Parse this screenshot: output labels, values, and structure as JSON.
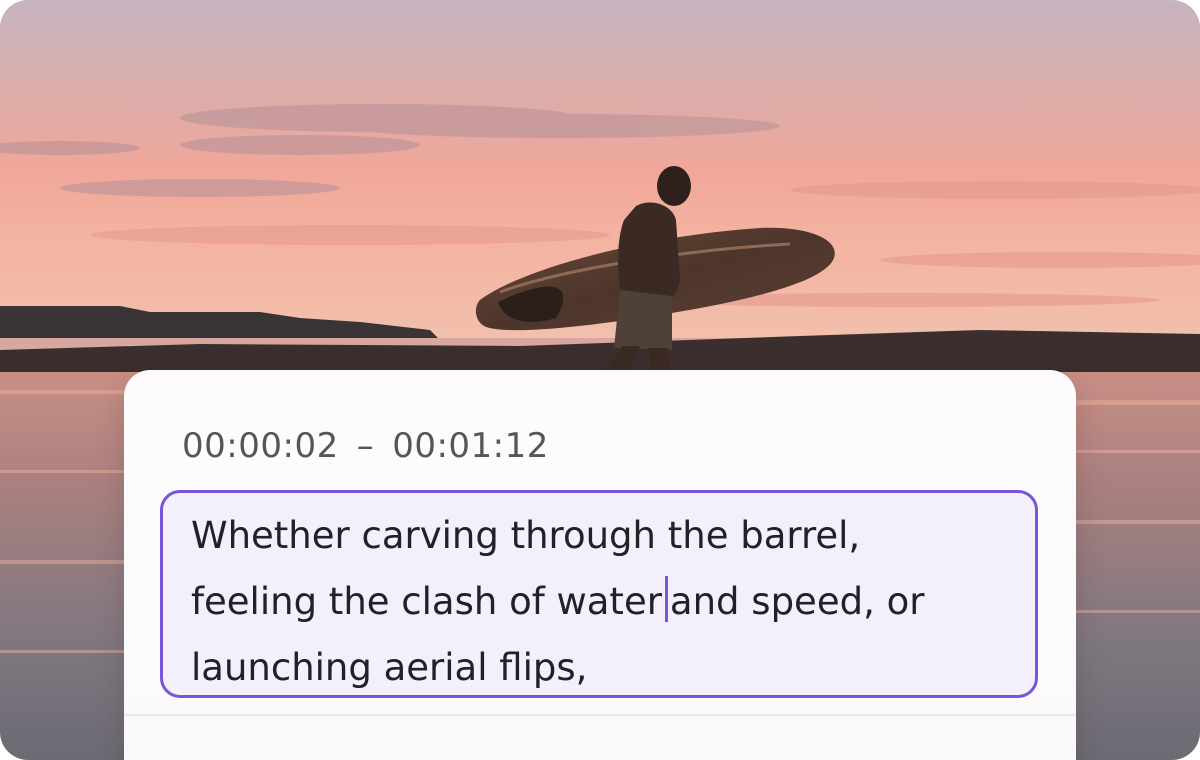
{
  "caption": {
    "start_time": "00:00:02",
    "separator": "–",
    "end_time": "00:01:12",
    "lines": [
      "Whether carving through the barrel,",
      "feeling the clash of water",
      "and speed, or",
      "launching aerial flips,"
    ]
  },
  "colors": {
    "accent": "#7b55d9",
    "editor_bg": "#f3effb",
    "text": "#222126",
    "timecode": "#56565a"
  }
}
